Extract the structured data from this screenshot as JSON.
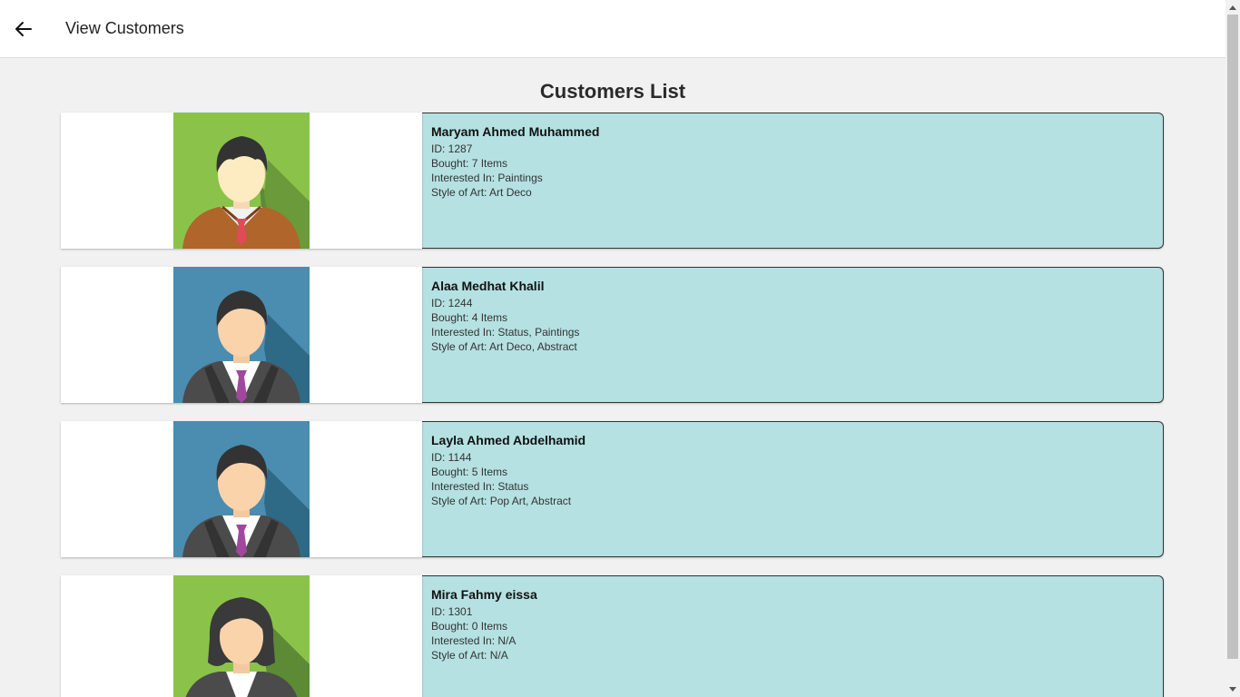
{
  "appbar": {
    "title": "View Customers",
    "back_icon": "arrow-left-icon"
  },
  "heading": "Customers List",
  "customers": [
    {
      "name": "Maryam Ahmed Muhammed",
      "id": "ID: 1287",
      "bought": "Bought: 7 Items",
      "interested": "Interested In: Paintings",
      "style": "Style of Art: Art Deco",
      "avatar": "male-avatar-green"
    },
    {
      "name": "Alaa Medhat Khalil",
      "id": "ID: 1244",
      "bought": "Bought: 4 Items",
      "interested": "Interested In: Status, Paintings",
      "style": "Style of Art: Art Deco, Abstract",
      "avatar": "male-avatar-blue"
    },
    {
      "name": "Layla Ahmed Abdelhamid",
      "id": "ID: 1144",
      "bought": "Bought: 5 Items",
      "interested": "Interested In: Status",
      "style": "Style of Art: Pop Art, Abstract",
      "avatar": "male-avatar-blue"
    },
    {
      "name": "Mira Fahmy eissa",
      "id": "ID: 1301",
      "bought": "Bought: 0 Items",
      "interested": "Interested In: N/A",
      "style": "Style of Art: N/A",
      "avatar": "female-avatar-green"
    }
  ],
  "colors": {
    "info_bg": "#b5e1e2",
    "green_avatar": "#8bc34a",
    "blue_avatar": "#4a8db0"
  }
}
